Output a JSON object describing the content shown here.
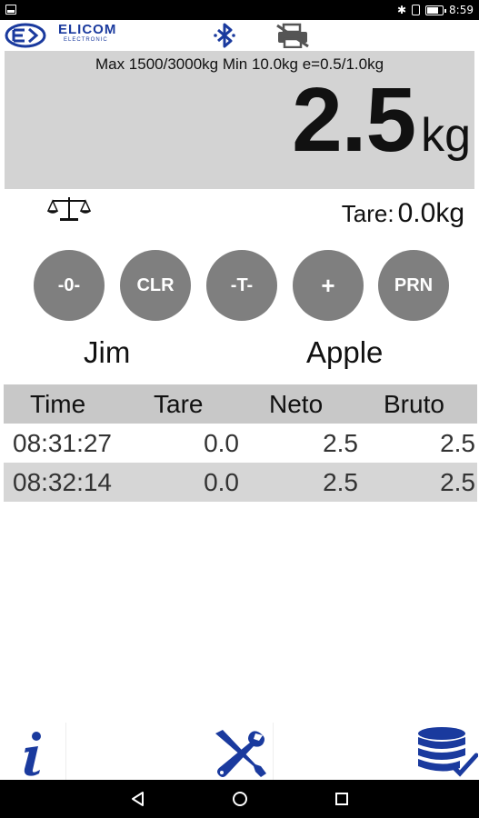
{
  "status_bar": {
    "time": "8:59"
  },
  "header": {
    "logo_text": "ELICOM",
    "logo_subtext": "ELECTRONIC",
    "bluetooth_icon": "bluetooth-icon",
    "printer_icon": "printer-disabled-icon"
  },
  "display": {
    "spec_text": "Max 1500/3000kg  Min 10.0kg  e=0.5/1.0kg",
    "weight_value": "2.5",
    "weight_unit": "kg"
  },
  "tare": {
    "label": "Tare:",
    "value": "0.0",
    "unit": "kg"
  },
  "buttons": [
    {
      "label": "-0-"
    },
    {
      "label": "CLR"
    },
    {
      "label": "-T-"
    },
    {
      "label": "+"
    },
    {
      "label": "PRN"
    }
  ],
  "names": {
    "left": "Jim",
    "right": "Apple"
  },
  "table": {
    "headers": [
      "Time",
      "Tare",
      "Neto",
      "Bruto"
    ],
    "rows": [
      [
        "08:31:27",
        "0.0",
        "2.5",
        "2.5"
      ],
      [
        "08:32:14",
        "0.0",
        "2.5",
        "2.5"
      ]
    ]
  },
  "toolbar": {
    "info_icon": "info-icon",
    "settings_icon": "tools-icon",
    "database_icon": "database-check-icon"
  },
  "colors": {
    "accent": "#1a3a9e",
    "button": "#7f7f7f",
    "display_bg": "#d3d3d3"
  }
}
